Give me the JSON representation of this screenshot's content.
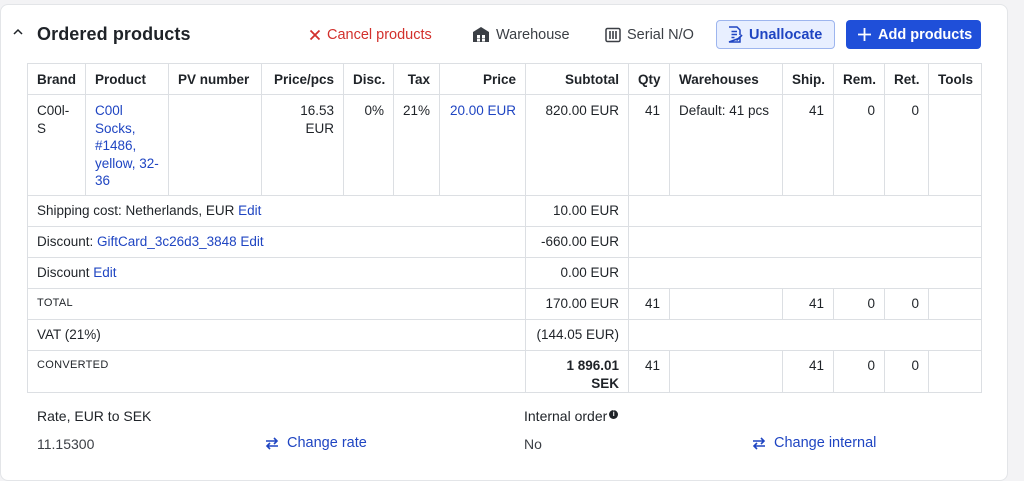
{
  "header": {
    "title": "Ordered products",
    "toolbar": {
      "cancel_label": "Cancel products",
      "warehouse_label": "Warehouse",
      "serial_label": "Serial N/O",
      "unallocate_label": "Unallocate",
      "add_label": "Add products"
    }
  },
  "table": {
    "columns": [
      "Brand",
      "Product",
      "PV number",
      "Price/pcs",
      "Disc.",
      "Tax",
      "Price",
      "Subtotal",
      "Qty",
      "Warehouses",
      "Ship.",
      "Rem.",
      "Ret.",
      "Tools"
    ],
    "product_row": {
      "brand": "C00l-S",
      "product": "C00l Socks, #1486, yellow, 32-36",
      "pv_number": "",
      "price_pcs": "16.53 EUR",
      "disc": "0%",
      "tax": "21%",
      "price": "20.00 EUR",
      "subtotal": "820.00 EUR",
      "qty": "41",
      "warehouses": "Default: 41 pcs",
      "ship": "41",
      "rem": "0",
      "ret": "0"
    },
    "shipping": {
      "label": "Shipping cost: Netherlands, EUR",
      "edit": "Edit",
      "amount": "10.00 EUR"
    },
    "discount_giftcard": {
      "label": "Discount:",
      "code": "GiftCard_3c26d3_3848",
      "edit": "Edit",
      "amount": "-660.00 EUR"
    },
    "discount": {
      "label": "Discount",
      "edit": "Edit",
      "amount": "0.00 EUR"
    },
    "total": {
      "label": "TOTAL",
      "amount": "170.00 EUR",
      "qty": "41",
      "ship": "41",
      "rem": "0",
      "ret": "0"
    },
    "vat": {
      "label": "VAT (21%)",
      "amount": "(144.05 EUR)"
    },
    "converted": {
      "label": "CONVERTED",
      "amount": "1 896.01 SEK",
      "qty": "41",
      "ship": "41",
      "rem": "0",
      "ret": "0"
    }
  },
  "footer": {
    "rate_label": "Rate, EUR to SEK",
    "rate_value": "11.15300",
    "change_rate": "Change rate",
    "internal_label": "Internal order",
    "internal_value": "No",
    "change_internal": "Change internal"
  },
  "colors": {
    "accent": "#1f4fd9",
    "link": "#1f45c2",
    "danger": "#d2302c",
    "unallocate_bg": "#e8efff"
  },
  "icons": [
    "chevron-up-icon",
    "close-icon",
    "warehouse-icon",
    "barcode-icon",
    "document-edit-icon",
    "plus-icon",
    "swap-icon",
    "info-icon"
  ]
}
